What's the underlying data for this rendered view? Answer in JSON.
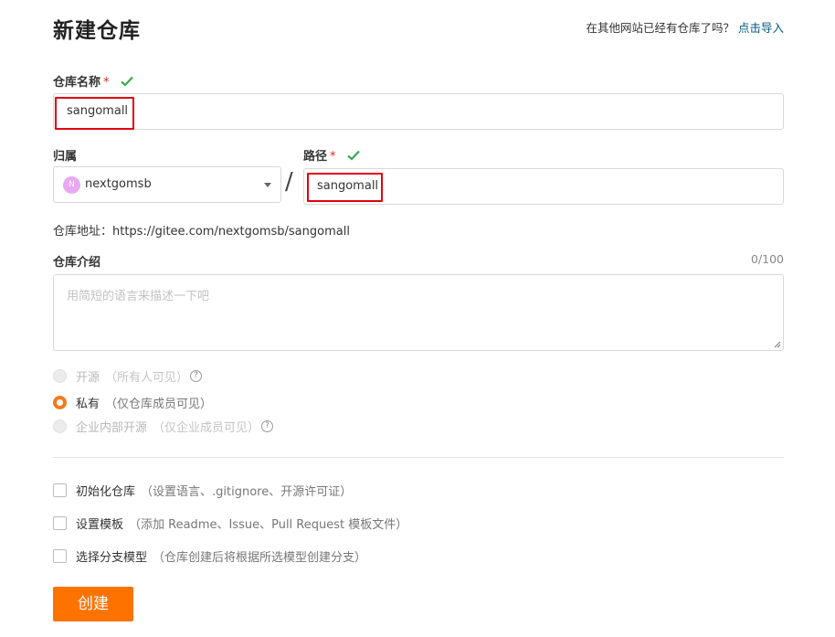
{
  "header": {
    "title": "新建仓库",
    "import_prompt": "在其他网站已经有仓库了吗？",
    "import_link": "点击导入"
  },
  "repo_name": {
    "label": "仓库名称",
    "required_mark": "*",
    "value": "sangomall"
  },
  "owner": {
    "label": "归属",
    "avatar_letter": "N",
    "value": "nextgomsb"
  },
  "path": {
    "separator": "/",
    "label": "路径",
    "required_mark": "*",
    "value": "sangomall"
  },
  "repo_url": {
    "text": "仓库地址：https://gitee.com/nextgomsb/sangomall"
  },
  "description": {
    "label": "仓库介绍",
    "counter": "0/100",
    "placeholder": "用简短的语言来描述一下吧"
  },
  "visibility": {
    "options": [
      {
        "label": "开源",
        "note": "（所有人可见）",
        "state": "disabled"
      },
      {
        "label": "私有",
        "note": "（仅仓库成员可见）",
        "state": "selected"
      },
      {
        "label": "企业内部开源",
        "note": "（仅企业成员可见）",
        "state": "disabled"
      }
    ],
    "help_glyph": "?"
  },
  "options": [
    {
      "label": "初始化仓库",
      "note": "（设置语言、.gitignore、开源许可证）",
      "checked": false
    },
    {
      "label": "设置模板",
      "note": "（添加 Readme、Issue、Pull Request 模板文件）",
      "checked": false
    },
    {
      "label": "选择分支模型",
      "note": "（仓库创建后将根据所选模型创建分支）",
      "checked": false
    }
  ],
  "submit": {
    "label": "创建"
  },
  "colors": {
    "accent": "#fe7300",
    "required": "#db2828",
    "valid": "#3aa856",
    "link": "#005980",
    "highlight": "#e0000f"
  },
  "icons": {
    "valid": "check-icon",
    "owner_dropdown": "caret-down-icon",
    "help": "question-circle-icon",
    "resize": "resize-grip-icon"
  }
}
